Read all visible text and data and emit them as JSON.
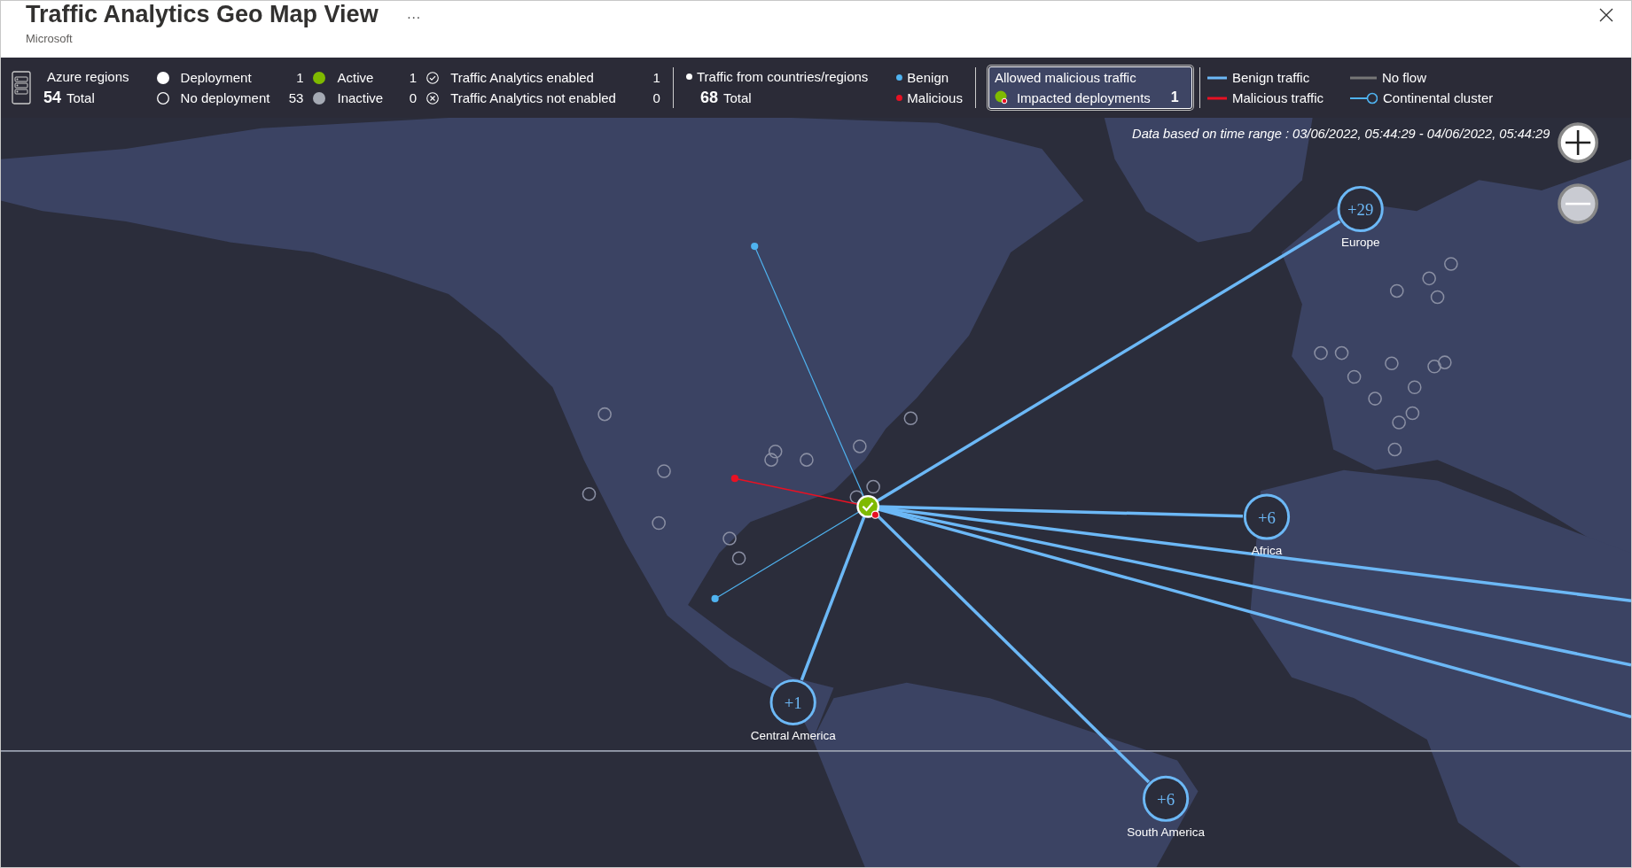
{
  "header": {
    "title": "Traffic Analytics Geo Map View",
    "subtitle": "Microsoft",
    "more": "···"
  },
  "legend": {
    "azure_regions": {
      "label": "Azure regions",
      "count": "54",
      "total_label": "Total"
    },
    "region_stats": [
      {
        "kind": "deployment",
        "label": "Deployment",
        "count": "1"
      },
      {
        "kind": "no_deployment",
        "label": "No deployment",
        "count": "53"
      },
      {
        "kind": "active",
        "label": "Active",
        "count": "1"
      },
      {
        "kind": "inactive",
        "label": "Inactive",
        "count": "0"
      },
      {
        "kind": "ta_enabled",
        "label": "Traffic Analytics enabled",
        "count": "1"
      },
      {
        "kind": "ta_not_enabled",
        "label": "Traffic Analytics not enabled",
        "count": "0"
      }
    ],
    "traffic": {
      "label": "Traffic from countries/regions",
      "count": "68",
      "total_label": "Total"
    },
    "traffic_types": [
      {
        "label": "Benign",
        "color": "#4fb3f0"
      },
      {
        "label": "Malicious",
        "color": "#e81123"
      }
    ],
    "malicious_box": {
      "title": "Allowed malicious traffic",
      "label": "Impacted deployments",
      "count": "1"
    },
    "line_types": [
      {
        "kind": "benign",
        "label": "Benign traffic"
      },
      {
        "kind": "malicious",
        "label": "Malicious traffic"
      },
      {
        "kind": "no_flow",
        "label": "No flow"
      },
      {
        "kind": "cluster",
        "label": "Continental cluster"
      }
    ]
  },
  "map": {
    "time_range": "Data based on time range : 03/06/2022, 05:44:29 - 04/06/2022, 05:44:29",
    "clusters": [
      {
        "count": "+29",
        "name": "Europe"
      },
      {
        "count": "+6",
        "name": "Africa"
      },
      {
        "count": "+1",
        "name": "Central America"
      },
      {
        "count": "+6",
        "name": "South America"
      }
    ]
  }
}
